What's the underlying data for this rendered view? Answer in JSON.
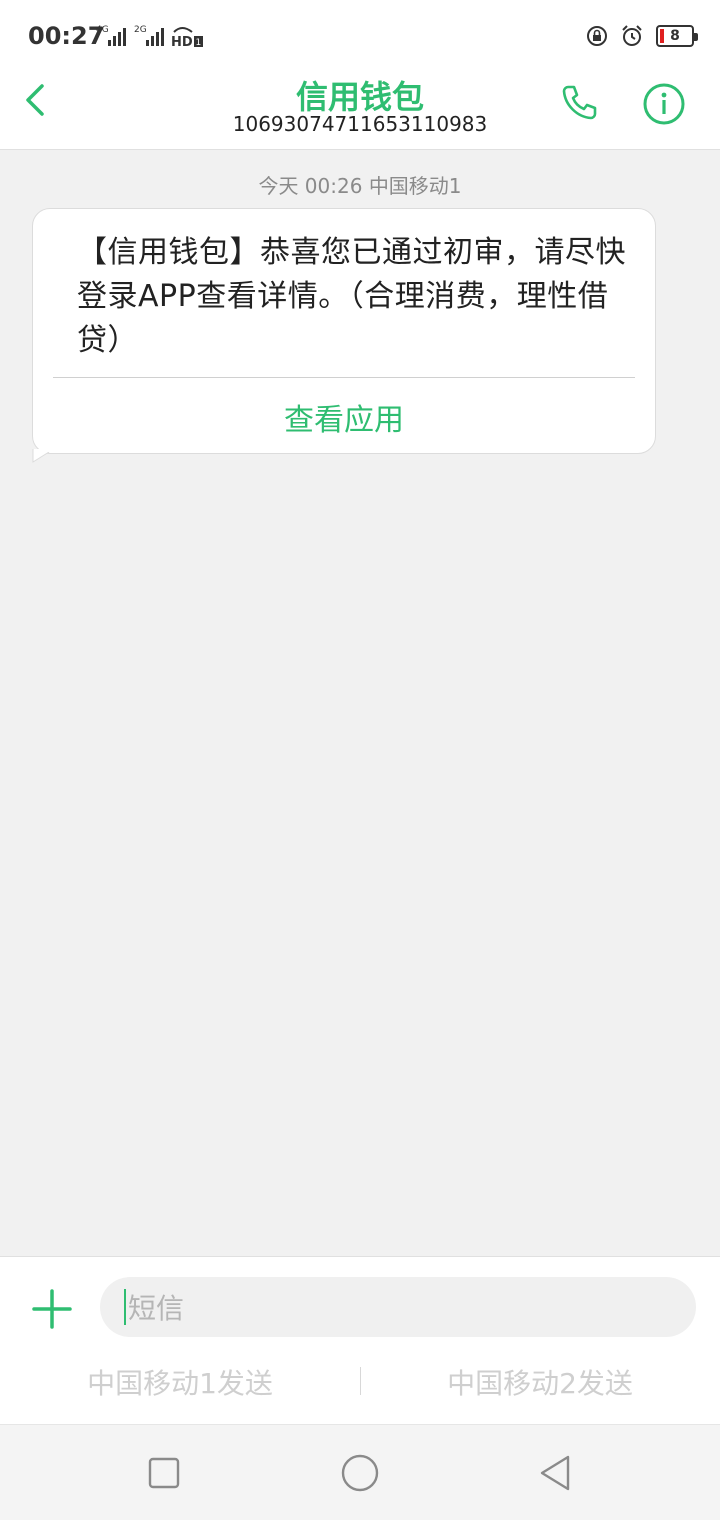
{
  "status_bar": {
    "time": "00:27",
    "network_1": "4G",
    "network_2": "2G",
    "hd_label": "HD",
    "battery_level": "8",
    "icons": [
      "signal-icon",
      "hd-voice-icon",
      "rotation-lock-icon",
      "alarm-icon",
      "battery-icon"
    ]
  },
  "header": {
    "title": "信用钱包",
    "phone_number": "10693074711653110983",
    "accent_color": "#2fbd71"
  },
  "thread": {
    "timestamp": "今天 00:26",
    "carrier": "中国移动1",
    "message": {
      "text": "【信用钱包】恭喜您已通过初审，请尽快登录APP查看详情。（合理消费，理性借贷）",
      "action_label": "查看应用"
    }
  },
  "composer": {
    "placeholder": "短信",
    "send_sim1": "中国移动1发送",
    "send_sim2": "中国移动2发送"
  },
  "navbar": {
    "icons": [
      "recent-apps-icon",
      "home-icon",
      "back-nav-icon"
    ]
  }
}
